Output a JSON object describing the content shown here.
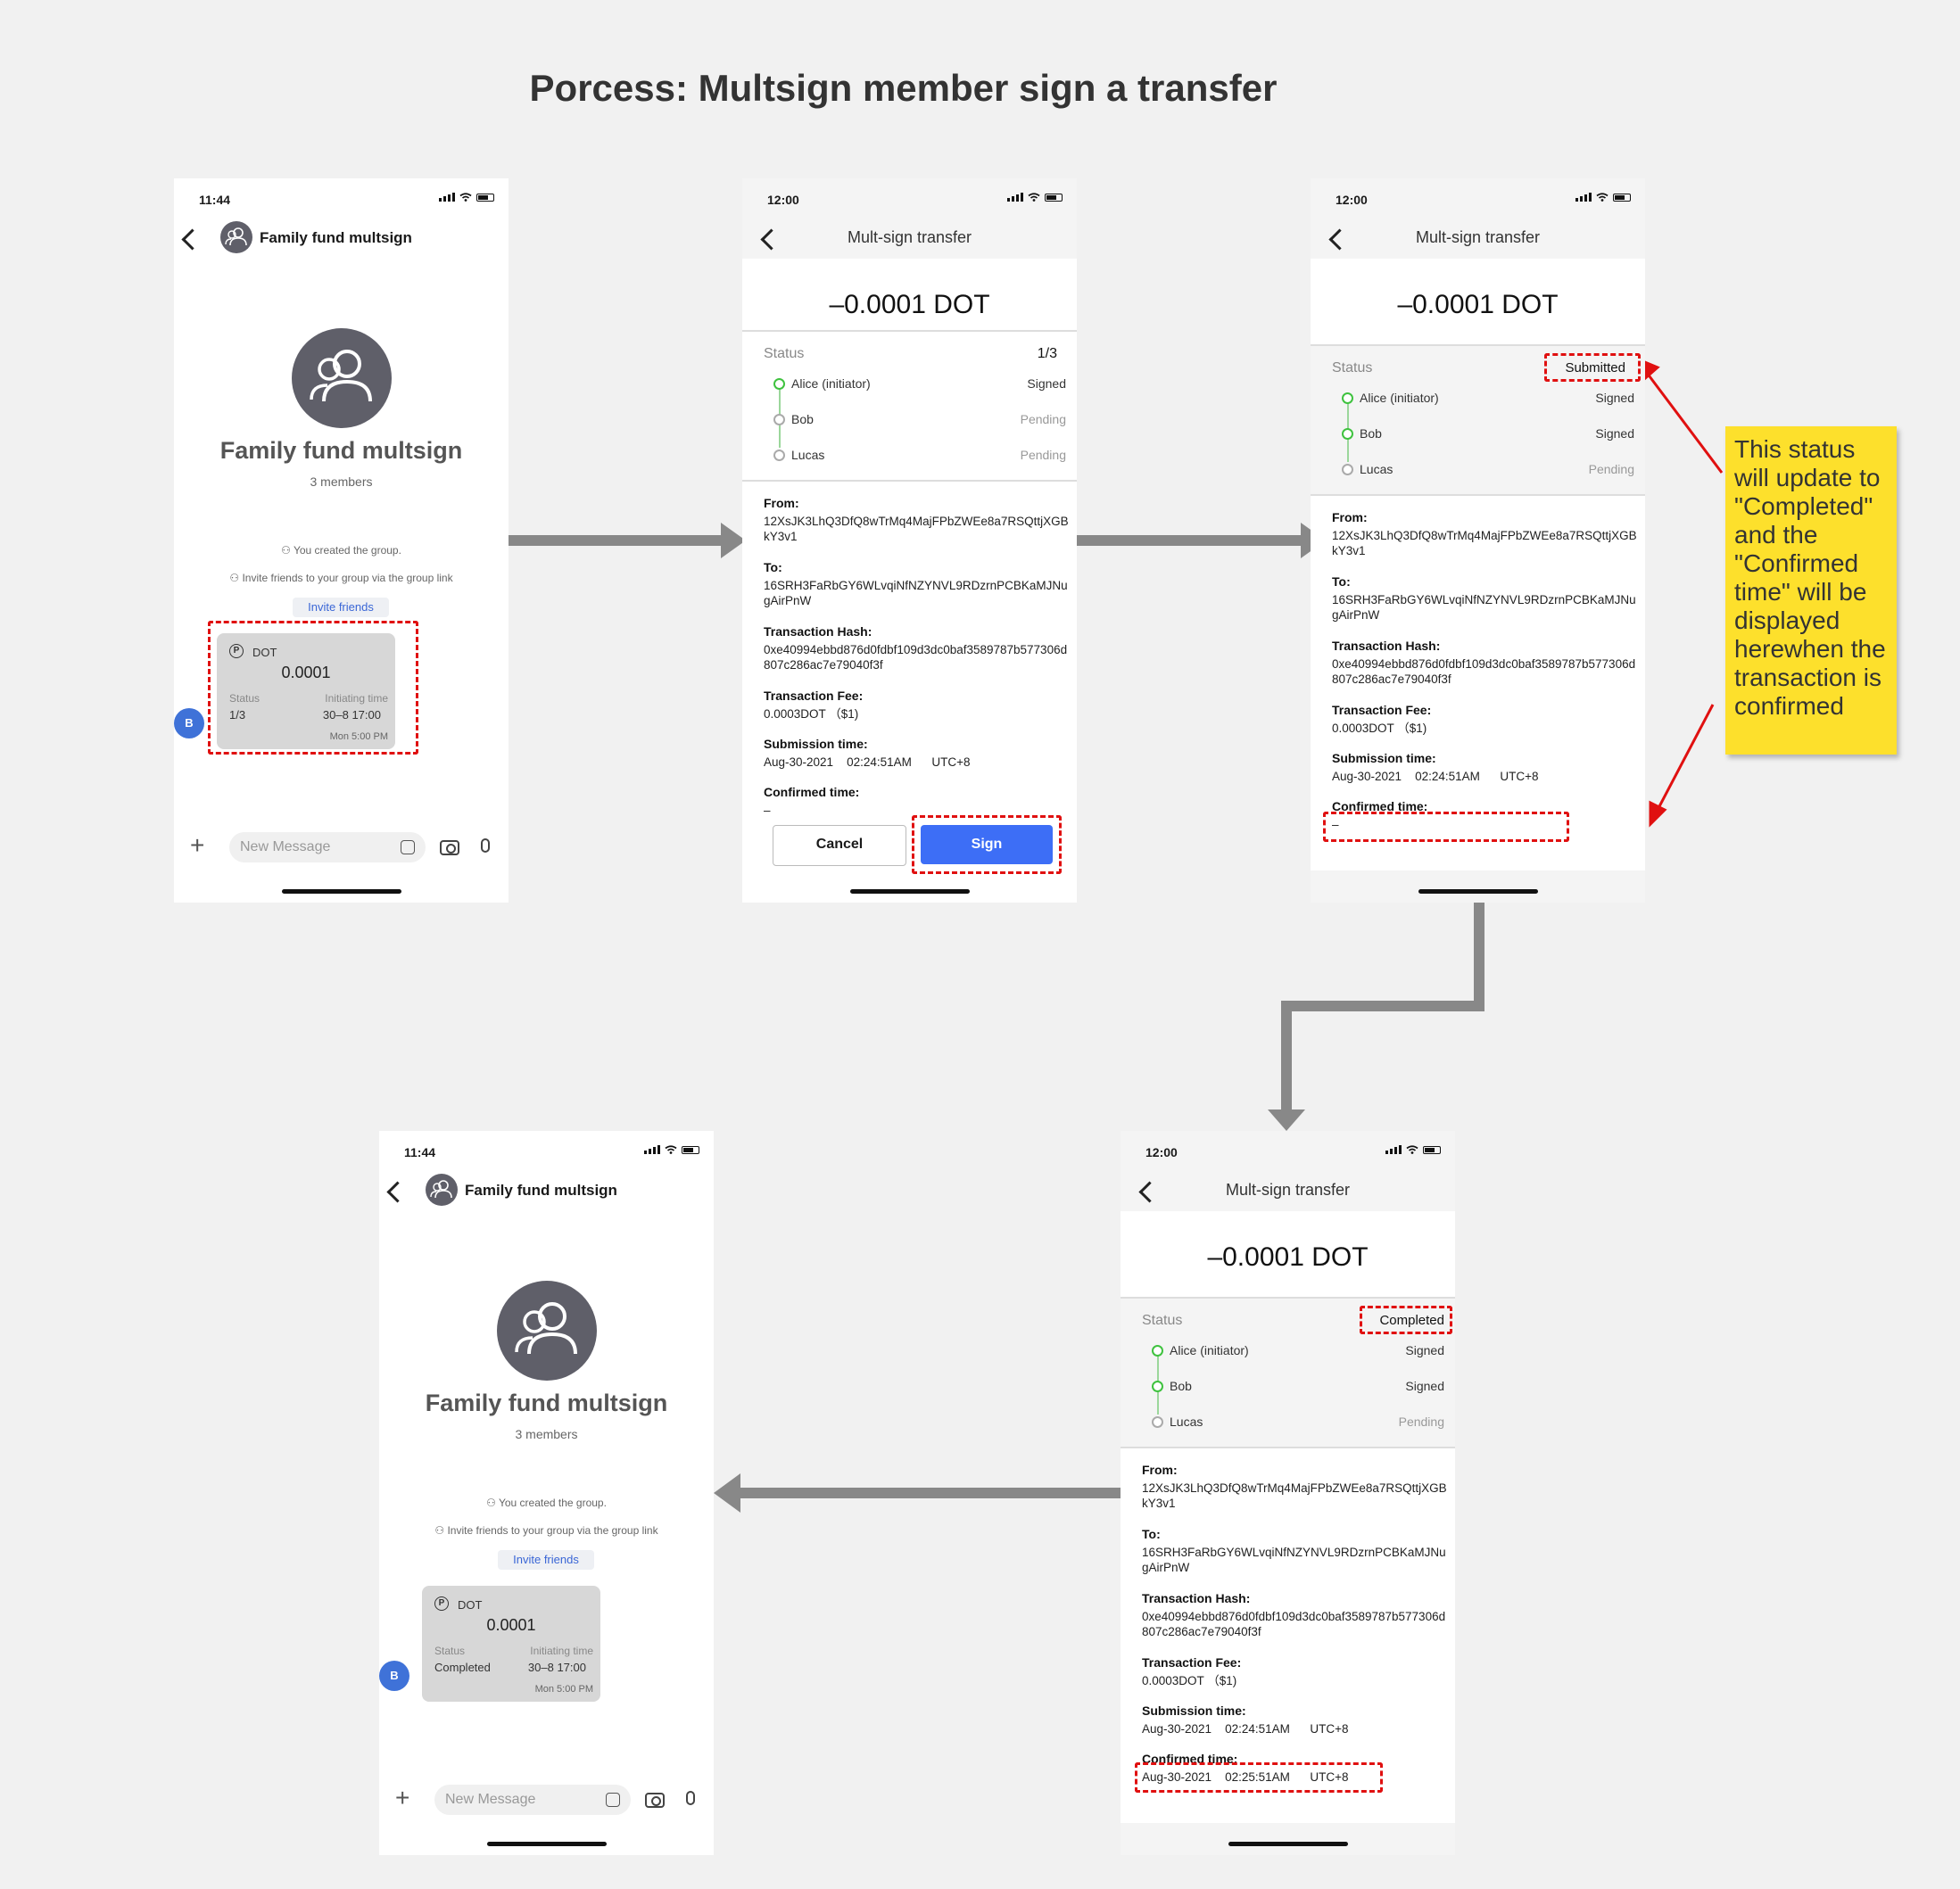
{
  "title": "Porcess: Multsign member sign a transfer",
  "note": "This status will update to \"Completed\" and the \"Confirmed time\" will be displayed herewhen the transaction is confirmed",
  "chat": {
    "time": "11:44",
    "group_name": "Family fund multsign",
    "members": "3 members",
    "created_msg": "You created the group.",
    "invite_msg": "Invite friends to your group via the group link",
    "invite_button": "Invite friends",
    "sender_initial": "B",
    "placeholder": "New Message",
    "card": {
      "coin": "DOT",
      "amount": "0.0001",
      "status_label": "Status",
      "initiating_label": "Initiating time",
      "initiating_value": "30–8 17:00",
      "timestamp": "Mon 5:00 PM"
    },
    "status_before": "1/3",
    "status_after": "Completed"
  },
  "transfer": {
    "time": "12:00",
    "header": "Mult-sign transfer",
    "amount": "–0.0001 DOT",
    "status_label": "Status",
    "members": [
      {
        "name": "Alice  (initiator)"
      },
      {
        "name": "Bob"
      },
      {
        "name": "Lucas"
      }
    ],
    "signed": "Signed",
    "pending": "Pending",
    "from_label": "From:",
    "from_value": "12XsJK3LhQ3DfQ8wTrMq4MajFPbZWEe8a7RSQttjXGBkY3v1",
    "to_label": "To:",
    "to_value": "16SRH3FaRbGY6WLvqiNfNZYNVL9RDzrnPCBKaMJNugAirPnW",
    "hash_label": "Transaction Hash:",
    "hash_value": "0xe40994ebbd876d0fdbf109d3dc0baf3589787b577306d807c286ac7e79040f3f",
    "fee_label": "Transaction Fee:",
    "fee_value": "0.0003DOT （$1)",
    "submission_label": "Submission time:",
    "submission_value": "Aug-30-2021    02:24:51AM      UTC+8",
    "confirmed_label": "Confirmed time:",
    "confirmed_empty": "–",
    "confirmed_value": "Aug-30-2021    02:25:51AM      UTC+8",
    "cancel": "Cancel",
    "sign": "Sign",
    "screen1_status": "1/3",
    "screen2_status": "Submitted",
    "screen3_status": "Completed"
  },
  "colors": {
    "highlight": "#e01010",
    "arrow": "#888888",
    "accent": "#3d6ef6",
    "note": "#fde02c",
    "signed_dot": "#3fc23f"
  }
}
